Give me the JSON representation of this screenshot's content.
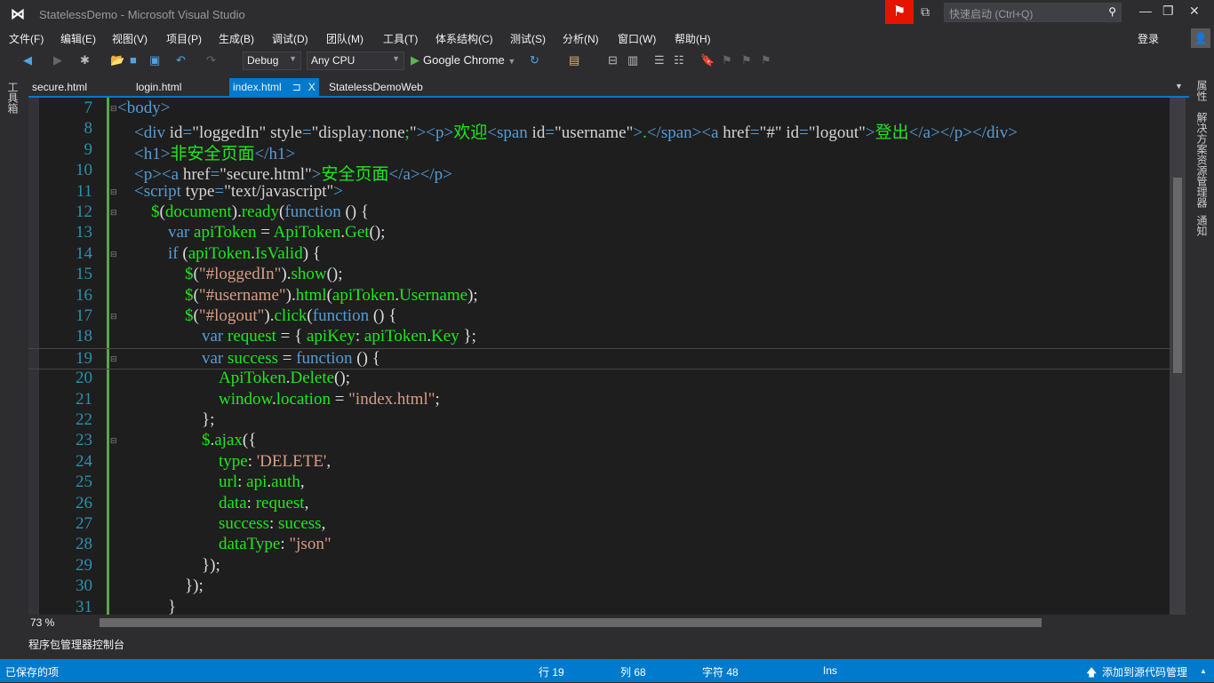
{
  "window": {
    "title": "StatelessDemo - Microsoft Visual Studio",
    "quick_launch_placeholder": "快速启动 (Ctrl+Q)",
    "login": "登录"
  },
  "menu": [
    "文件(F)",
    "编辑(E)",
    "视图(V)",
    "项目(P)",
    "生成(B)",
    "调试(D)",
    "团队(M)",
    "工具(T)",
    "体系结构(C)",
    "测试(S)",
    "分析(N)",
    "窗口(W)",
    "帮助(H)"
  ],
  "toolbar": {
    "configuration": "Debug",
    "platform": "Any CPU",
    "start_target": "Google Chrome"
  },
  "left_tool": "工具箱",
  "tabs": [
    {
      "label": "secure.html"
    },
    {
      "label": "login.html"
    },
    {
      "label": "index.html",
      "active": true,
      "pin": "⊐",
      "close": "X"
    },
    {
      "label": "StatelessDemoWeb"
    }
  ],
  "right_tabs": [
    "属性",
    "解决方案资源管理器",
    "通知"
  ],
  "editor": {
    "zoom": "73 %",
    "current_line": 19,
    "lines": [
      {
        "n": 7,
        "fold": true,
        "i": 0,
        "tk": [
          [
            "t",
            "<body>"
          ]
        ]
      },
      {
        "n": 8,
        "i": 1,
        "tk": [
          [
            "t",
            "<div "
          ],
          [
            "a",
            "id"
          ],
          [
            "t",
            "="
          ],
          [
            "v",
            "\"loggedIn\" "
          ],
          [
            "a",
            "style"
          ],
          [
            "t",
            "="
          ],
          [
            "v",
            "\"display"
          ],
          [
            "t",
            ":"
          ],
          [
            "v",
            "none"
          ],
          [
            "g",
            ";"
          ],
          [
            "v",
            "\""
          ],
          [
            "t",
            "><p>"
          ],
          [
            "g",
            "欢迎"
          ],
          [
            "t",
            "<span "
          ],
          [
            "a",
            "id"
          ],
          [
            "t",
            "="
          ],
          [
            "v",
            "\"username\""
          ],
          [
            "t",
            ">"
          ],
          [
            "g",
            "."
          ],
          [
            "t",
            "</span><a "
          ],
          [
            "a",
            "href"
          ],
          [
            "t",
            "="
          ],
          [
            "v",
            "\"#\" "
          ],
          [
            "a",
            "id"
          ],
          [
            "t",
            "="
          ],
          [
            "v",
            "\"logout\""
          ],
          [
            "t",
            ">"
          ],
          [
            "g",
            "登出"
          ],
          [
            "t",
            "</a></p></div>"
          ]
        ]
      },
      {
        "n": 9,
        "i": 1,
        "tk": [
          [
            "t",
            "<h1>"
          ],
          [
            "g",
            "非安全页面"
          ],
          [
            "t",
            "</h1>"
          ]
        ]
      },
      {
        "n": 10,
        "i": 1,
        "tk": [
          [
            "t",
            "<p><a "
          ],
          [
            "a",
            "href"
          ],
          [
            "t",
            "="
          ],
          [
            "v",
            "\"secure.html\""
          ],
          [
            "t",
            ">"
          ],
          [
            "g",
            "安全页面"
          ],
          [
            "t",
            "</a></p>"
          ]
        ]
      },
      {
        "n": 11,
        "fold": true,
        "i": 1,
        "tk": [
          [
            "t",
            "<script "
          ],
          [
            "a",
            "type"
          ],
          [
            "t",
            "="
          ],
          [
            "v",
            "\"text/javascript\""
          ],
          [
            "t",
            ">"
          ]
        ]
      },
      {
        "n": 12,
        "fold": true,
        "i": 2,
        "tk": [
          [
            "g",
            "$"
          ],
          [
            "p",
            "("
          ],
          [
            "g",
            "document"
          ],
          [
            "p",
            ")."
          ],
          [
            "g",
            "ready"
          ],
          [
            "p",
            "("
          ],
          [
            "k",
            "function"
          ],
          [
            "p",
            " () {"
          ]
        ]
      },
      {
        "n": 13,
        "i": 3,
        "tk": [
          [
            "k",
            "var "
          ],
          [
            "g",
            "apiToken"
          ],
          [
            "p",
            " = "
          ],
          [
            "g",
            "ApiToken"
          ],
          [
            "p",
            "."
          ],
          [
            "g",
            "Get"
          ],
          [
            "p",
            "();"
          ]
        ]
      },
      {
        "n": 14,
        "fold": true,
        "i": 3,
        "tk": [
          [
            "k",
            "if "
          ],
          [
            "p",
            "("
          ],
          [
            "g",
            "apiToken"
          ],
          [
            "p",
            "."
          ],
          [
            "g",
            "IsValid"
          ],
          [
            "p",
            ") {"
          ]
        ]
      },
      {
        "n": 15,
        "i": 4,
        "tk": [
          [
            "g",
            "$"
          ],
          [
            "p",
            "("
          ],
          [
            "s",
            "\"#loggedIn\""
          ],
          [
            "p",
            ")."
          ],
          [
            "g",
            "show"
          ],
          [
            "p",
            "();"
          ]
        ]
      },
      {
        "n": 16,
        "i": 4,
        "tk": [
          [
            "g",
            "$"
          ],
          [
            "p",
            "("
          ],
          [
            "s",
            "\"#username\""
          ],
          [
            "p",
            ")."
          ],
          [
            "g",
            "html"
          ],
          [
            "p",
            "("
          ],
          [
            "g",
            "apiToken"
          ],
          [
            "p",
            "."
          ],
          [
            "g",
            "Username"
          ],
          [
            "p",
            ");"
          ]
        ]
      },
      {
        "n": 17,
        "fold": true,
        "i": 4,
        "tk": [
          [
            "g",
            "$"
          ],
          [
            "p",
            "("
          ],
          [
            "s",
            "\"#logout\""
          ],
          [
            "p",
            ")."
          ],
          [
            "g",
            "click"
          ],
          [
            "p",
            "("
          ],
          [
            "k",
            "function"
          ],
          [
            "p",
            " () {"
          ]
        ]
      },
      {
        "n": 18,
        "i": 5,
        "tk": [
          [
            "k",
            "var "
          ],
          [
            "g",
            "request"
          ],
          [
            "p",
            " = { "
          ],
          [
            "g",
            "apiKey"
          ],
          [
            "p",
            ": "
          ],
          [
            "g",
            "apiToken"
          ],
          [
            "p",
            "."
          ],
          [
            "g",
            "Key"
          ],
          [
            "p",
            " };"
          ]
        ]
      },
      {
        "n": 19,
        "fold": true,
        "i": 5,
        "tk": [
          [
            "k",
            "var "
          ],
          [
            "g",
            "success"
          ],
          [
            "p",
            " = "
          ],
          [
            "k",
            "function"
          ],
          [
            "p",
            " () {"
          ]
        ]
      },
      {
        "n": 20,
        "i": 6,
        "tk": [
          [
            "g",
            "ApiToken"
          ],
          [
            "p",
            "."
          ],
          [
            "g",
            "Delete"
          ],
          [
            "p",
            "();"
          ]
        ]
      },
      {
        "n": 21,
        "i": 6,
        "tk": [
          [
            "g",
            "window"
          ],
          [
            "p",
            "."
          ],
          [
            "g",
            "location"
          ],
          [
            "p",
            " = "
          ],
          [
            "s",
            "\"index.html\""
          ],
          [
            "p",
            ";"
          ]
        ]
      },
      {
        "n": 22,
        "i": 5,
        "tk": [
          [
            "p",
            "};"
          ]
        ]
      },
      {
        "n": 23,
        "fold": true,
        "i": 5,
        "tk": [
          [
            "g",
            "$"
          ],
          [
            "p",
            "."
          ],
          [
            "g",
            "ajax"
          ],
          [
            "p",
            "({"
          ]
        ]
      },
      {
        "n": 24,
        "i": 6,
        "tk": [
          [
            "g",
            "type"
          ],
          [
            "p",
            ": "
          ],
          [
            "s",
            "'DELETE'"
          ],
          [
            "p",
            ","
          ]
        ]
      },
      {
        "n": 25,
        "i": 6,
        "tk": [
          [
            "g",
            "url"
          ],
          [
            "p",
            ": "
          ],
          [
            "g",
            "api"
          ],
          [
            "p",
            "."
          ],
          [
            "g",
            "auth"
          ],
          [
            "p",
            ","
          ]
        ]
      },
      {
        "n": 26,
        "i": 6,
        "tk": [
          [
            "g",
            "data"
          ],
          [
            "p",
            ": "
          ],
          [
            "g",
            "request"
          ],
          [
            "p",
            ","
          ]
        ]
      },
      {
        "n": 27,
        "i": 6,
        "tk": [
          [
            "g",
            "success"
          ],
          [
            "p",
            ": "
          ],
          [
            "g",
            "sucess"
          ],
          [
            "p",
            ","
          ]
        ]
      },
      {
        "n": 28,
        "i": 6,
        "tk": [
          [
            "g",
            "dataType"
          ],
          [
            "p",
            ": "
          ],
          [
            "s",
            "\"json\""
          ]
        ]
      },
      {
        "n": 29,
        "i": 5,
        "tk": [
          [
            "p",
            "});"
          ]
        ]
      },
      {
        "n": 30,
        "i": 4,
        "tk": [
          [
            "p",
            "});"
          ]
        ]
      },
      {
        "n": 31,
        "i": 3,
        "tk": [
          [
            "p",
            "}"
          ]
        ]
      }
    ]
  },
  "bottom_panel": "程序包管理器控制台",
  "status": {
    "message": "已保存的项",
    "line": "行 19",
    "col": "列 68",
    "char": "字符 48",
    "mode": "Ins",
    "source_control": "添加到源代码管理"
  },
  "colors": {
    "accent": "#007acc",
    "background": "#1e1e1e",
    "tag": "#569cd6",
    "identifier": "#1ee81e",
    "string": "#d69d85",
    "line_number": "#2b91af"
  }
}
